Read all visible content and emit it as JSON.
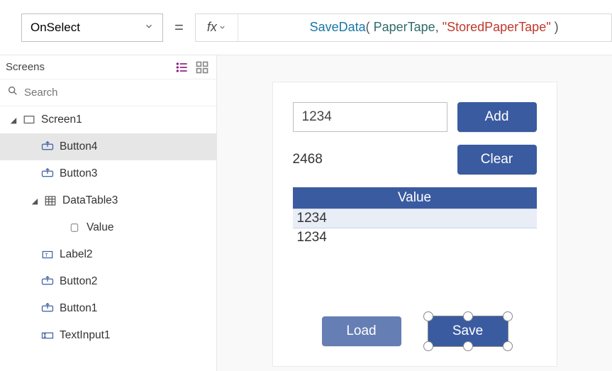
{
  "topbar": {
    "property": "OnSelect",
    "fx_label": "fx",
    "formula": {
      "func": "SaveData",
      "open": "( ",
      "arg1": "PaperTape",
      "comma": ", ",
      "arg2": "\"StoredPaperTape\"",
      "close": " )"
    }
  },
  "tree": {
    "title": "Screens",
    "search_placeholder": "Search",
    "items": [
      {
        "name": "Screen1",
        "kind": "screen",
        "indent": "root",
        "label": "Screen1"
      },
      {
        "name": "Button4",
        "kind": "button",
        "indent": "child",
        "label": "Button4",
        "selected": true
      },
      {
        "name": "Button3",
        "kind": "button",
        "indent": "child",
        "label": "Button3"
      },
      {
        "name": "DataTable3",
        "kind": "table",
        "indent": "child-c",
        "label": "DataTable3"
      },
      {
        "name": "Value",
        "kind": "column",
        "indent": "grand",
        "label": "Value"
      },
      {
        "name": "Label2",
        "kind": "label",
        "indent": "child",
        "label": "Label2"
      },
      {
        "name": "Button2",
        "kind": "button",
        "indent": "child",
        "label": "Button2"
      },
      {
        "name": "Button1",
        "kind": "button",
        "indent": "child",
        "label": "Button1"
      },
      {
        "name": "TextInput1",
        "kind": "textinput",
        "indent": "child",
        "label": "TextInput1"
      }
    ]
  },
  "canvas": {
    "text_input_value": "1234",
    "result_label": "2468",
    "add_label": "Add",
    "clear_label": "Clear",
    "table_header": "Value",
    "table_rows": [
      "1234",
      "1234"
    ],
    "load_label": "Load",
    "save_label": "Save"
  },
  "colors": {
    "primary": "#3a5ba0",
    "accent": "#8a1a7a"
  }
}
